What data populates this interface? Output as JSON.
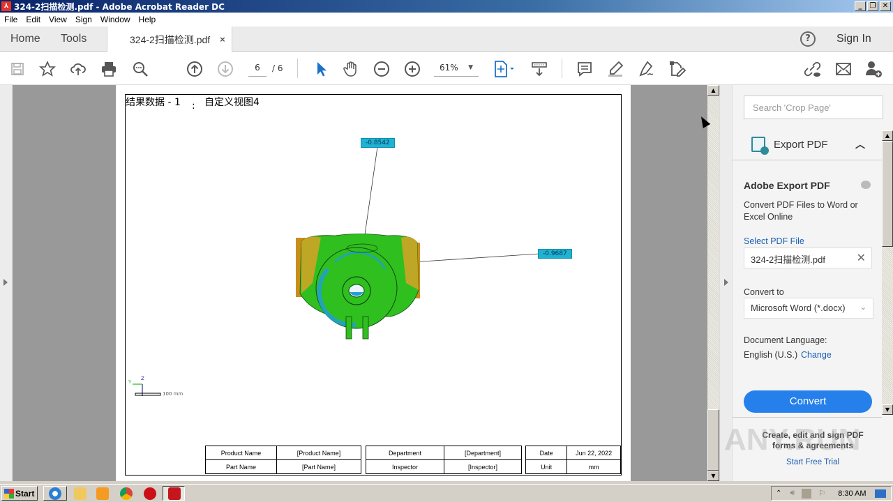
{
  "window": {
    "title": "324-2扫描检测.pdf - Adobe Acrobat Reader DC",
    "controls": {
      "minimize": "_",
      "restore": "❐",
      "close": "✕"
    }
  },
  "menu": [
    "File",
    "Edit",
    "View",
    "Sign",
    "Window",
    "Help"
  ],
  "tabs": {
    "home": "Home",
    "tools": "Tools",
    "document": "324-2扫描检测.pdf",
    "close": "×",
    "help": "?",
    "sign_in": "Sign In"
  },
  "toolbar": {
    "current_page": "6",
    "total_pages": "/ 6",
    "zoom": "61%",
    "icons": [
      "save-icon",
      "bookmark-star-icon",
      "upload-cloud-icon",
      "print-icon",
      "find-icon",
      "prev-page-icon",
      "next-page-icon",
      "select-cursor-icon",
      "hand-icon",
      "zoom-out-icon",
      "zoom-in-icon",
      "fit-page-icon",
      "scroll-mode-icon",
      "comment-icon",
      "highlight-icon",
      "sign-icon",
      "fill-sign-icon",
      "share-link-icon",
      "email-icon",
      "add-user-icon"
    ]
  },
  "document": {
    "title_left": "结果数据 - 1",
    "title_colon": ":",
    "title_right": "自定义视图4",
    "labels": [
      {
        "value": "-0.8542"
      },
      {
        "value": "-0.9687"
      }
    ],
    "axis": {
      "y": "Y",
      "z": "Z",
      "scale": "100 mm"
    },
    "info_table": [
      [
        "Product Name",
        "[Product Name]",
        "Department",
        "[Department]",
        "Date",
        "Jun 22, 2022"
      ],
      [
        "Part Name",
        "[Part Name]",
        "Inspector",
        "[Inspector]",
        "Unit",
        "mm"
      ]
    ]
  },
  "right_panel": {
    "search_placeholder": "Search 'Crop Page'",
    "export_header": "Export PDF",
    "heading": "Adobe Export PDF",
    "description": "Convert PDF Files to Word or Excel Online",
    "select_file": "Select PDF File",
    "file_name": "324-2扫描检测.pdf",
    "convert_to_label": "Convert to",
    "convert_to_value": "Microsoft Word (*.docx)",
    "doc_lang_label": "Document Language:",
    "doc_lang_value": "English (U.S.)",
    "change": "Change",
    "convert_button": "Convert",
    "promo_text": "Create, edit and sign PDF forms & agreements",
    "promo_link": "Start Free Trial"
  },
  "taskbar": {
    "start": "Start",
    "clock": "8:30 AM"
  },
  "watermark": "ANY.RUN"
}
